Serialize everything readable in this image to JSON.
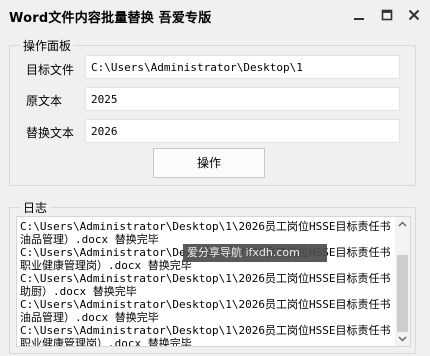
{
  "window": {
    "title": "Word文件内容批量替换 吾爱专版"
  },
  "ops_panel": {
    "legend": "操作面板",
    "target_label": "目标文件",
    "target_value": "C:\\Users\\Administrator\\Desktop\\1",
    "original_label": "原文本",
    "original_value": "2025",
    "replace_label": "替换文本",
    "replace_value": "2026",
    "button_label": "操作"
  },
  "log_panel": {
    "legend": "日志",
    "lines": [
      "C:\\Users\\Administrator\\Desktop\\1\\2026员工岗位HSSE目标责任书（",
      "油品管理）.docx 替换完毕",
      "C:\\Users\\Administrator\\Desktop\\1\\2026员工岗位HSSE目标责任书（",
      "职业健康管理岗）.docx 替换完毕",
      "C:\\Users\\Administrator\\Desktop\\1\\2026员工岗位HSSE目标责任书（",
      "助厨）.docx 替换完毕",
      "C:\\Users\\Administrator\\Desktop\\1\\2026员工岗位HSSE目标责任书（",
      "油品管理）.docx 替换完毕",
      "C:\\Users\\Administrator\\Desktop\\1\\2026员工岗位HSSE目标责任书（",
      "职业健康管理岗）.docx 替换完毕"
    ]
  },
  "watermark": {
    "text": "爱分享导航 ifxdh.com"
  },
  "icons": [
    "minimize-icon",
    "maximize-icon",
    "close-icon",
    "scroll-up-icon",
    "scroll-down-icon"
  ]
}
